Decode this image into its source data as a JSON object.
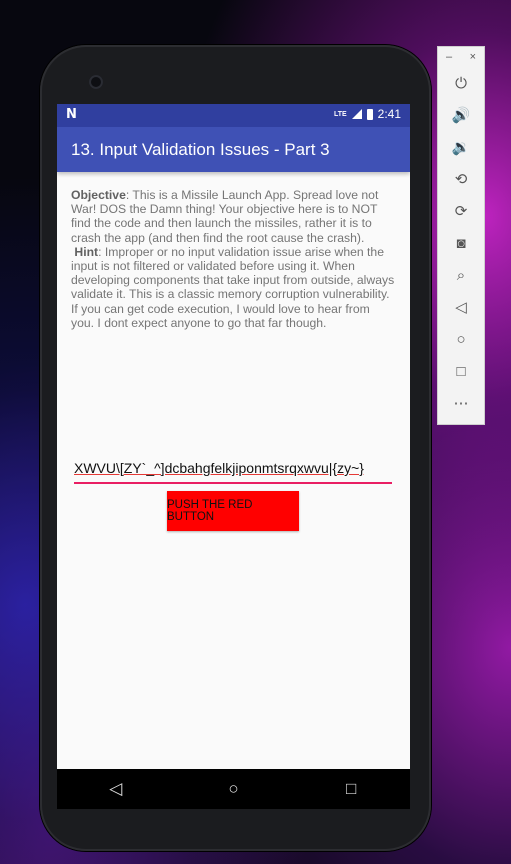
{
  "status_bar": {
    "notification": "N",
    "network": "LTE",
    "time": "2:41"
  },
  "app_bar": {
    "title": "13. Input Validation Issues - Part 3"
  },
  "content": {
    "objective_label": "Objective",
    "objective_text": ": This is a Missile Launch App. Spread love not War! DOS the Damn thing! Your objective here is to NOT find the code and then launch the missiles, rather it is to crash the app (and then find the root cause the crash).",
    "hint_label": "Hint",
    "hint_text": ": Improper or no input validation issue arise when the input is not filtered or validated before using it. When developing components that take input from outside, always validate it. This is a classic memory corruption vulnerability. If you can get code execution, I would love to hear from you. I dont expect anyone to go that far though."
  },
  "code_input": {
    "value": "XWVU\\[ZY`_^]dcbahgfelkjiponmtsrqxwvu|{zy~}"
  },
  "red_button": {
    "label": "PUSH THE RED BUTTON",
    "color": "#ff0000"
  },
  "nav": {
    "back_icon": "back-icon",
    "home_icon": "home-icon",
    "recents_icon": "recents-icon"
  },
  "emulator_toolbar": {
    "minimize": "–",
    "close": "×",
    "items": [
      "power-icon",
      "volume-up-icon",
      "volume-down-icon",
      "rotate-left-icon",
      "rotate-right-icon",
      "camera-icon",
      "zoom-icon",
      "back-icon",
      "home-icon",
      "overview-icon",
      "more-icon"
    ]
  },
  "colors": {
    "primary": "#3f51b5",
    "primary_dark": "#303f9f",
    "accent": "#e91e63"
  }
}
